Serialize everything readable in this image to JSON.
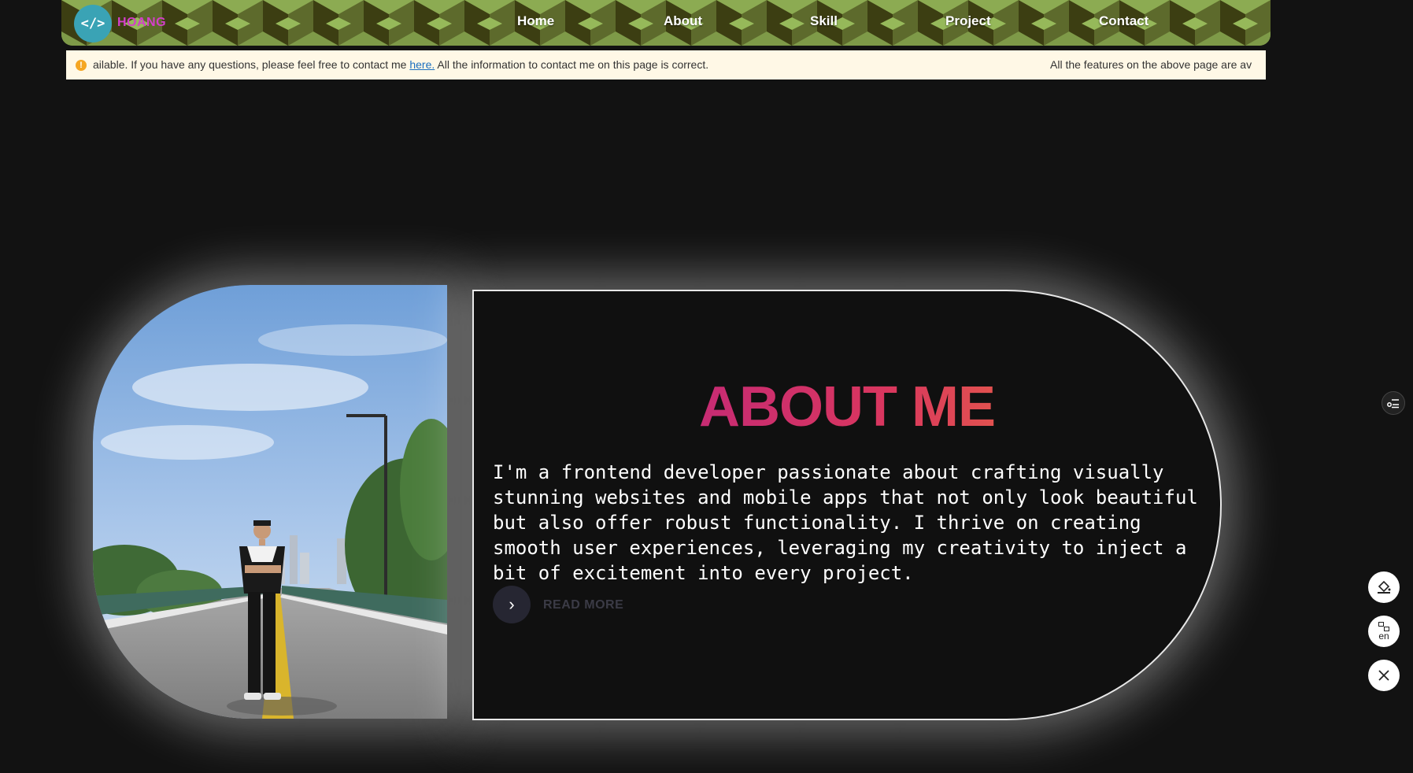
{
  "navbar": {
    "logo_glyph": "</>",
    "brand": "HOANG",
    "links": [
      "Home",
      "About",
      "Skill",
      "Project",
      "Contact"
    ]
  },
  "notice": {
    "icon": "warning-icon",
    "text_before_link": "ailable. If you have any questions, please feel free to contact me ",
    "link_text": "here.",
    "text_after_link": " All the information to contact me on this page is correct.",
    "trailing_text": "All the features on the above page are av"
  },
  "about": {
    "title": "ABOUT ME",
    "body": "I'm a frontend developer passionate about crafting visually stunning websites and mobile apps that not only look beautiful but also offer robust functionality. I thrive on creating smooth user experiences, leveraging my creativity to inject a bit of excitement into every project.",
    "read_more_icon": "chevron-right-icon",
    "read_more_label": "READ MORE",
    "title_gradient": [
      "#b01e8c",
      "#d9365f",
      "#f2892f"
    ]
  },
  "widgets": {
    "toggle_icon": "menu-list-icon",
    "paint_icon": "paint-bucket-icon",
    "language_code": "en",
    "translate_icon": "translate-icon",
    "close_icon": "close-icon"
  },
  "colors": {
    "background": "#121212",
    "navbar_green": "#6e8a3c",
    "logo_bg": "#3aa3b5",
    "brand": "#d43fc9",
    "notice_bg": "#fff8e6"
  }
}
